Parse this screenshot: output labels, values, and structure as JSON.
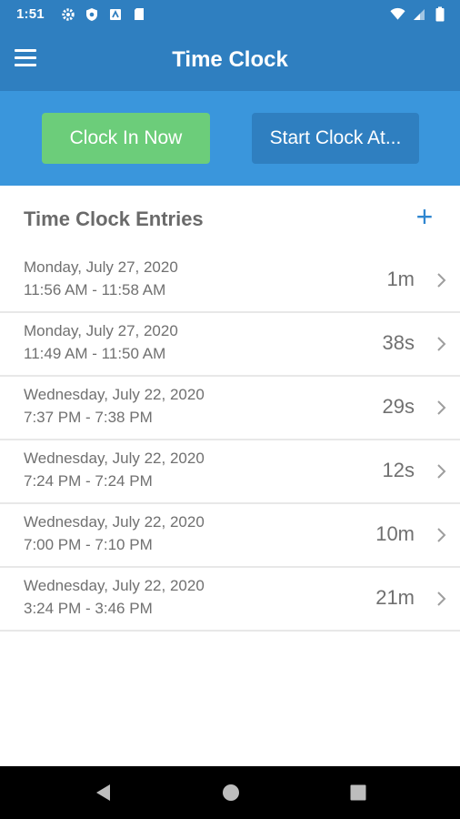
{
  "status": {
    "time": "1:51",
    "left_icons": [
      "gear-icon",
      "shield-icon",
      "notification-icon",
      "sd-card-icon"
    ],
    "right_icons": [
      "wifi-icon",
      "signal-icon",
      "battery-icon"
    ]
  },
  "app_bar": {
    "title": "Time Clock",
    "menu_icon": "hamburger-menu-icon"
  },
  "actions": {
    "clock_in_label": "Clock In Now",
    "start_at_label": "Start Clock At...",
    "clock_in_color": "#6ccd7a",
    "start_at_color": "#2f7fc0"
  },
  "entries": {
    "title": "Time Clock Entries",
    "add_label": "+",
    "items": [
      {
        "date": "Monday, July 27, 2020",
        "range": "11:56 AM - 11:58 AM",
        "duration": "1m"
      },
      {
        "date": "Monday, July 27, 2020",
        "range": "11:49 AM - 11:50 AM",
        "duration": "38s"
      },
      {
        "date": "Wednesday, July 22, 2020",
        "range": "7:37 PM - 7:38 PM",
        "duration": "29s"
      },
      {
        "date": "Wednesday, July 22, 2020",
        "range": "7:24 PM - 7:24 PM",
        "duration": "12s"
      },
      {
        "date": "Wednesday, July 22, 2020",
        "range": "7:00 PM - 7:10 PM",
        "duration": "10m"
      },
      {
        "date": "Wednesday, July 22, 2020",
        "range": "3:24 PM - 3:46 PM",
        "duration": "21m"
      }
    ]
  },
  "colors": {
    "primary": "#2f7fc0",
    "accent_band": "#3a96dc",
    "success": "#6ccd7a",
    "text_muted": "#707070"
  }
}
